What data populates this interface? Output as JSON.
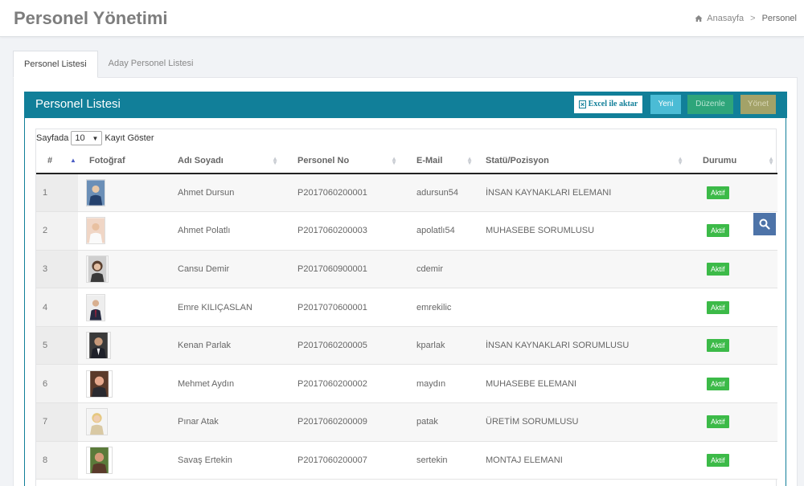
{
  "page": {
    "title": "Personel Yönetimi",
    "breadcrumb": {
      "home": "Anasayfa",
      "separator": ">",
      "current": "Personel"
    }
  },
  "tabs": [
    {
      "label": "Personel Listesi",
      "active": true
    },
    {
      "label": "Aday Personel Listesi",
      "active": false
    }
  ],
  "panel": {
    "title": "Personel Listesi",
    "buttons": {
      "excel": "Excel ile aktar",
      "yeni": "Yeni",
      "duzenle": "Düzenle",
      "yonet": "Yönet"
    }
  },
  "table_length": {
    "prefix": "Sayfada",
    "value": "10",
    "suffix": "Kayıt Göster"
  },
  "columns": [
    "#",
    "Fotoğraf",
    "Adı Soyadı",
    "Personel No",
    "E-Mail",
    "Statü/Pozisyon",
    "Durumu"
  ],
  "rows": [
    {
      "num": "1",
      "name": "Ahmet Dursun",
      "no": "P2017060200001",
      "email": "adursun54",
      "position": "İNSAN KAYNAKLARI ELEMANI",
      "status": "Aktif"
    },
    {
      "num": "2",
      "name": "Ahmet Polatlı",
      "no": "P2017060200003",
      "email": "apolatlı54",
      "position": "MUHASEBE SORUMLUSU",
      "status": "Aktif"
    },
    {
      "num": "3",
      "name": "Cansu Demir",
      "no": "P2017060900001",
      "email": "cdemir",
      "position": "",
      "status": "Aktif"
    },
    {
      "num": "4",
      "name": "Emre KILIÇASLAN",
      "no": "P2017070600001",
      "email": "emrekilic",
      "position": "",
      "status": "Aktif"
    },
    {
      "num": "5",
      "name": "Kenan Parlak",
      "no": "P2017060200005",
      "email": "kparlak",
      "position": "İNSAN KAYNAKLARI SORUMLUSU",
      "status": "Aktif"
    },
    {
      "num": "6",
      "name": "Mehmet Aydın",
      "no": "P2017060200002",
      "email": "maydın",
      "position": "MUHASEBE ELEMANI",
      "status": "Aktif"
    },
    {
      "num": "7",
      "name": "Pınar Atak",
      "no": "P2017060200009",
      "email": "patak",
      "position": "ÜRETİM SORUMLUSU",
      "status": "Aktif"
    },
    {
      "num": "8",
      "name": "Savaş Ertekin",
      "no": "P2017060200007",
      "email": "sertekin",
      "position": "MONTAJ ELEMANI",
      "status": "Aktif"
    }
  ],
  "colors": {
    "accent": "#117f99",
    "status_active": "#3cba48",
    "btn_yeni": "#4bbcd5",
    "btn_duzenle": "#2ea57a",
    "btn_yonet": "#a3a268",
    "search_btn": "#4d73a8"
  },
  "icons": {
    "home": "home-icon",
    "excel": "excel-file-icon",
    "search": "search-icon",
    "sort": "sort-icon",
    "select_arrow": "chevron-down-icon"
  }
}
